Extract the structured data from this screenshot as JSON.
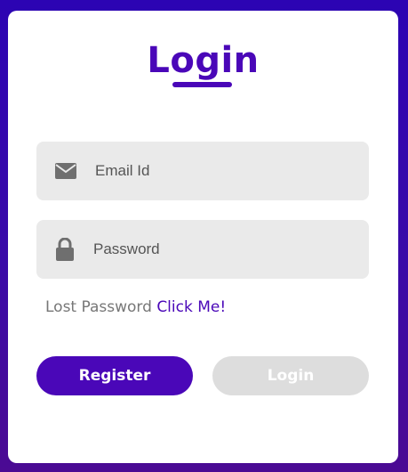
{
  "colors": {
    "accent": "#4a07b8",
    "field_bg": "#eaeaea",
    "disabled_button": "#dddddd"
  },
  "header": {
    "title": "Login"
  },
  "form": {
    "email": {
      "placeholder": "Email Id",
      "value": "",
      "icon": "envelope-icon"
    },
    "password": {
      "placeholder": "Password",
      "value": "",
      "icon": "lock-icon"
    },
    "lost_password_text": "Lost Password",
    "lost_password_link": "Click Me!"
  },
  "buttons": {
    "register_label": "Register",
    "login_label": "Login"
  }
}
